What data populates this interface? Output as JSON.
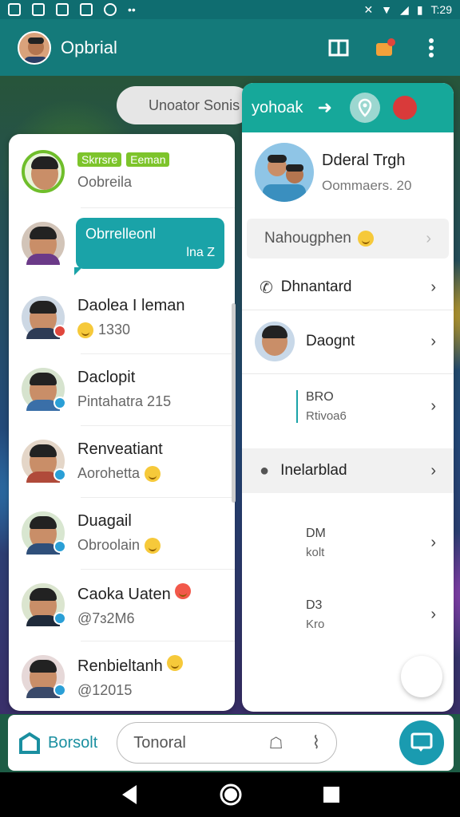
{
  "status_bar": {
    "time": "T:29"
  },
  "app_bar": {
    "title": "Opbrial"
  },
  "search": {
    "label": "Unoator Sonis"
  },
  "chats": [
    {
      "tags": [
        "Skrrsre",
        "Eeman"
      ],
      "subtitle": "Oobreila"
    },
    {
      "bubble_text": "Obrrelleonl",
      "bubble_meta": "lna Z"
    },
    {
      "name": "Daolea I leman",
      "subtitle": "1330",
      "emoji": true
    },
    {
      "name": "Daclopit",
      "subtitle": "Pintahatra 215"
    },
    {
      "name": "Renveatiant",
      "subtitle": "Aorohetta",
      "emoji": true
    },
    {
      "name": "Duagail",
      "subtitle": "Obroolain",
      "emoji": true
    },
    {
      "name": "Caoka Uaten",
      "subtitle": "@7ɜ2M6",
      "emoji_red": true
    },
    {
      "name": "Renbieltanh",
      "subtitle": "@12015",
      "emoji": true
    }
  ],
  "detail": {
    "header_title": "yohoak",
    "profile_name": "Dderal Trgh",
    "profile_meta": "Oommaers.",
    "profile_count": "20",
    "rows": {
      "nickname": "Nahougphen",
      "phone": "Dhnantard",
      "contact": "Daognt",
      "bro_title": "BRO",
      "bro_sub": "Rtivoa6",
      "block": "Inelarblad",
      "dm_title": "DM",
      "dm_sub": "kolt",
      "d3_title": "D3",
      "d3_sub": "Kro"
    }
  },
  "composer": {
    "brand": "Borsolt",
    "input": "Tonoral"
  },
  "colors": {
    "teal": "#147a7a",
    "accent": "#1aa3a8",
    "header_green": "#16a89a"
  }
}
